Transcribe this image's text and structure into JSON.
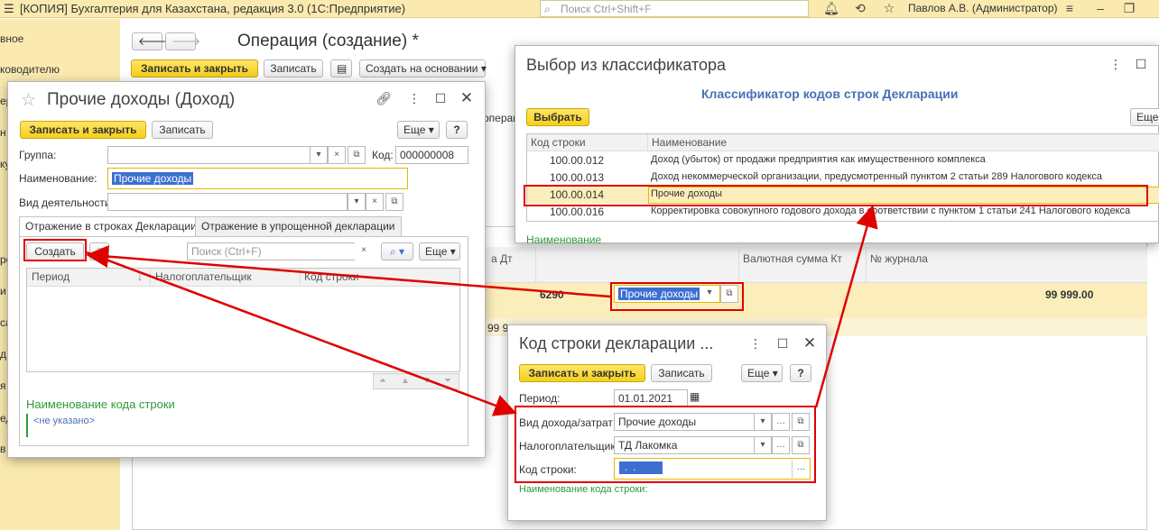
{
  "app": {
    "title": "[КОПИЯ] Бухгалтерия для Казахстана, редакция 3.0  (1С:Предприятие)",
    "search_placeholder": "Поиск Ctrl+Shift+F",
    "user": "Павлов А.В. (Администратор)"
  },
  "sidebar": [
    "вное",
    "ководителю",
    "ер",
    "н",
    "ку",
    "",
    "ро",
    "и",
    "са",
    "д",
    "я",
    "ед",
    "в"
  ],
  "main": {
    "title": "Операция (создание) *",
    "btn_save_close": "Записать и закрыть",
    "btn_save": "Записать",
    "btn_create_base": "Создать на основании",
    "partial_label": "операц",
    "col_dt": "а Дт",
    "col_val_kt": "Валютная сумма Кт",
    "col_journal": "№ журнала",
    "row_amount1": "6290",
    "row_field": "Прочие доходы",
    "row_total": "99 999.00",
    "row_amount2": "99 9"
  },
  "dlg_income": {
    "title": "Прочие доходы (Доход)",
    "btn_save_close": "Записать и закрыть",
    "btn_save": "Записать",
    "btn_more": "Еще",
    "btn_help": "?",
    "label_group": "Группа:",
    "label_code": "Код:",
    "code_value": "000000008",
    "label_name": "Наименование:",
    "name_value": "Прочие доходы",
    "label_activity": "Вид деятельности:",
    "tab1": "Отражение в строках Декларации",
    "tab2": "Отражение в упрощенной декларации",
    "btn_create": "Создать",
    "search_placeholder": "Поиск (Ctrl+F)",
    "btn_more2": "Еще",
    "col_period": "Период",
    "col_taxpayer": "Налогоплательщик",
    "col_code": "Код строки",
    "footer_title": "Наименование кода строки",
    "footer_value": "<не указано>"
  },
  "dlg_classifier": {
    "title": "Выбор из классификатора",
    "subtitle": "Классификатор кодов строк Декларации",
    "btn_select": "Выбрать",
    "btn_more": "Еще",
    "col_code": "Код строки",
    "col_name": "Наименование",
    "rows": [
      {
        "code": "100.00.012",
        "name": "Доход (убыток) от продажи предприятия как имущественного комплекса"
      },
      {
        "code": "100.00.013",
        "name": "Доход некоммерческой организации, предусмотренный пунктом 2 статьи 289 Налогового кодекса"
      },
      {
        "code": "100.00.014",
        "name": "Прочие доходы"
      },
      {
        "code": "100.00.016",
        "name": "Корректировка совокупного годового дохода в соответствии с пунктом 1 статьи 241 Налогового кодекса"
      }
    ],
    "footer": "Наименование"
  },
  "dlg_code": {
    "title": "Код строки декларации ...",
    "btn_save_close": "Записать и закрыть",
    "btn_save": "Записать",
    "btn_more": "Еще",
    "btn_help": "?",
    "label_period": "Период:",
    "period_value": "01.01.2021",
    "label_income_type": "Вид дохода/затрат:",
    "income_type_value": "Прочие доходы",
    "label_taxpayer": "Налогоплательщик:",
    "taxpayer_value": "ТД Лакомка",
    "label_code": "Код строки:",
    "code_value": "  .  .  ",
    "footer": "Наименование кода строки:"
  },
  "colors": {
    "accent": "#f5cf1c",
    "highlight": "#e00000",
    "panel": "#fbeab0"
  }
}
